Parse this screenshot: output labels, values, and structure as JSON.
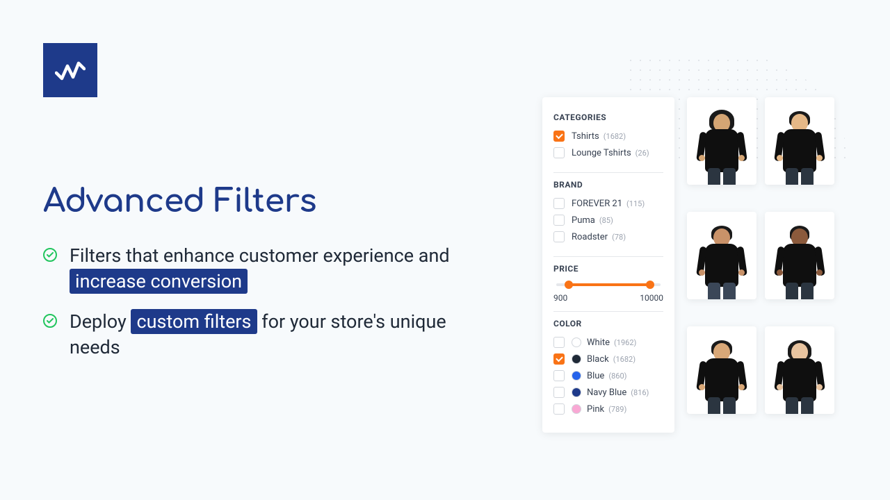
{
  "title": "Advanced Filters",
  "bullets": [
    {
      "pre": "Filters that enhance customer experience and ",
      "hl": "increase conversion",
      "post": ""
    },
    {
      "pre": "Deploy ",
      "hl": "custom filters",
      "post": " for your store's unique needs"
    }
  ],
  "filters": {
    "categories": {
      "title": "CATEGORIES",
      "items": [
        {
          "label": "Tshirts",
          "count": "(1682)",
          "checked": true
        },
        {
          "label": "Lounge Tshirts",
          "count": "(26)",
          "checked": false
        }
      ]
    },
    "brand": {
      "title": "BRAND",
      "items": [
        {
          "label": "FOREVER 21",
          "count": "(115)",
          "checked": false
        },
        {
          "label": "Puma",
          "count": "(85)",
          "checked": false
        },
        {
          "label": "Roadster",
          "count": "(78)",
          "checked": false
        }
      ]
    },
    "price": {
      "title": "PRICE",
      "min": "900",
      "max": "10000"
    },
    "color": {
      "title": "COLOR",
      "items": [
        {
          "label": "White",
          "count": "(1962)",
          "swatch": "#ffffff",
          "checked": false
        },
        {
          "label": "Black",
          "count": "(1682)",
          "swatch": "#1f2937",
          "checked": true
        },
        {
          "label": "Blue",
          "count": "(860)",
          "swatch": "#2563eb",
          "checked": false
        },
        {
          "label": "Navy Blue",
          "count": "(816)",
          "swatch": "#1e3a8a",
          "checked": false
        },
        {
          "label": "Pink",
          "count": "(789)",
          "swatch": "#f9a8d4",
          "checked": false
        }
      ]
    }
  }
}
